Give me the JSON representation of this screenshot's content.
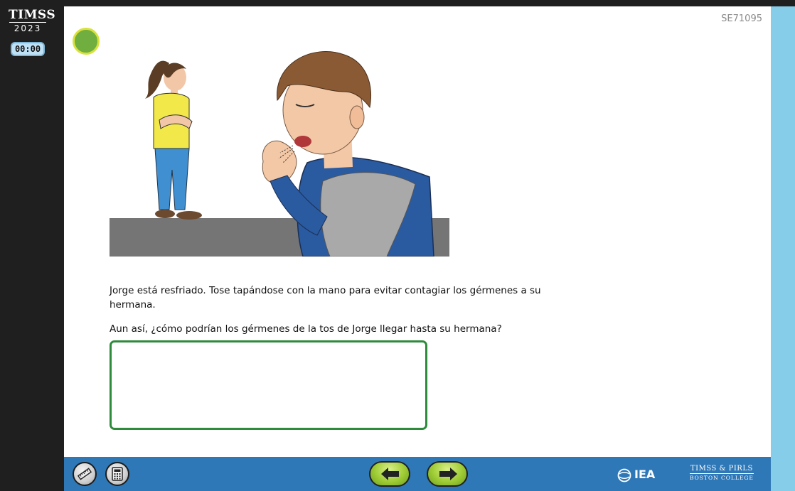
{
  "brand": {
    "line1": "TIMSS",
    "line2": "2023"
  },
  "timer": "00:00",
  "item_code": "SE71095",
  "stem": "Jorge está resfriado. Tose tapándose con la mano para evitar contagiar los gérmenes a su hermana.",
  "question": "Aun así, ¿cómo podrían los gérmenes de la tos de Jorge llegar hasta su hermana?",
  "answer": {
    "value": ""
  },
  "toolbar": {
    "ruler_icon": "ruler-icon",
    "calculator_icon": "calculator-icon",
    "back_icon": "arrow-left-icon",
    "next_icon": "arrow-right-icon"
  },
  "footer": {
    "iea": "IEA",
    "timss_pirls": "TIMSS & PIRLS",
    "boston_college": "BOSTON COLLEGE"
  },
  "colors": {
    "frame": "#1f1f1f",
    "side_panel": "#86cdea",
    "toolbar": "#2f78b7",
    "answer_border": "#2e8b3c",
    "status_dot": "#6fae3f",
    "nav_button": "#9fcc35"
  }
}
